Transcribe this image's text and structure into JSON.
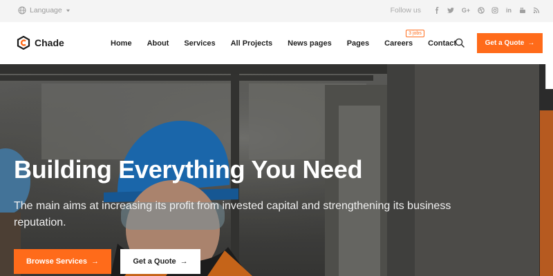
{
  "topbar": {
    "language_label": "Language",
    "follow_label": "Follow us",
    "socials": [
      "facebook-icon",
      "twitter-icon",
      "google-plus-icon",
      "dribbble-icon",
      "instagram-icon",
      "linkedin-icon",
      "youtube-icon",
      "rss-icon"
    ]
  },
  "nav": {
    "logo_text": "Chade",
    "items": [
      {
        "label": "Home"
      },
      {
        "label": "About"
      },
      {
        "label": "Services"
      },
      {
        "label": "All Projects"
      },
      {
        "label": "News pages"
      },
      {
        "label": "Pages"
      },
      {
        "label": "Careers",
        "badge": "3 jobs"
      },
      {
        "label": "Contact"
      }
    ],
    "quote_button": "Get a Quote",
    "arrow": "→"
  },
  "hero": {
    "title": "Building Everything You Need",
    "subtitle": "The main aims at increasing its profit from invested capital and strengthening its business reputation.",
    "primary_button": "Browse Services",
    "secondary_button": "Get a Quote",
    "arrow": "→"
  },
  "colors": {
    "accent": "#ff6b1a",
    "topbar_bg": "#f4f4f4",
    "text_dark": "#1e1e1e"
  }
}
